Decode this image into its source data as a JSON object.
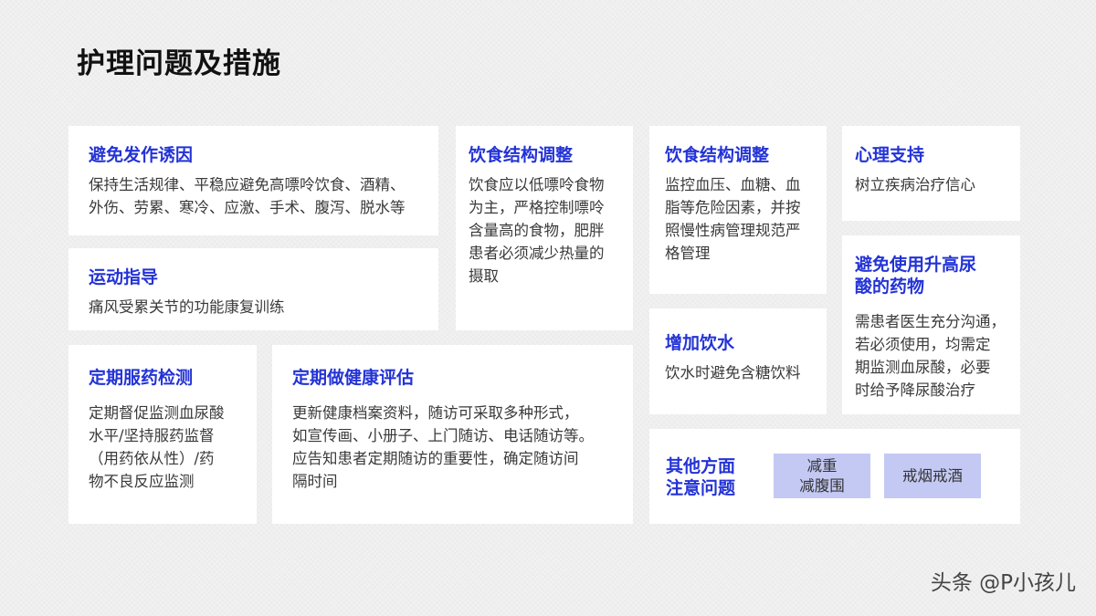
{
  "page_title": "护理问题及措施",
  "cards": {
    "avoid_triggers": {
      "title": "避免发作诱因",
      "lines": [
        "保持生活规律、平稳应避免高嘌呤饮食、酒精、",
        "外伤、劳累、寒冷、应激、手术、腹泻、脱水等"
      ]
    },
    "exercise": {
      "title": "运动指导",
      "lines": [
        "痛风受累关节的功能康复训练"
      ]
    },
    "diet1": {
      "title": "饮食结构调整",
      "lines": [
        "饮食应以低嘌呤食物",
        "为主，严格控制嘌呤",
        "含量高的食物，肥胖",
        "患者必须减少热量的",
        "摄取"
      ]
    },
    "diet2": {
      "title": "饮食结构调整",
      "lines": [
        "监控血压、血糖、血",
        "脂等危险因素，并按",
        "照慢性病管理规范严",
        "格管理"
      ]
    },
    "psych": {
      "title": "心理支持",
      "lines": [
        "树立疾病治疗信心"
      ]
    },
    "avoid_drugs": {
      "title_lines": [
        "避免使用升高尿",
        "酸的药物"
      ],
      "lines": [
        "需患者医生充分沟通，",
        "若必须使用，均需定",
        "期监测血尿酸，必要",
        "时给予降尿酸治疗"
      ]
    },
    "water": {
      "title": "增加饮水",
      "lines": [
        "饮水时避免含糖饮料"
      ]
    },
    "med_monitor": {
      "title": "定期服药检测",
      "lines": [
        "定期督促监测血尿酸",
        "水平/坚持服药监督",
        "（用药依从性）/药",
        "物不良反应监测"
      ]
    },
    "health_eval": {
      "title": "定期做健康评估",
      "lines": [
        "更新健康档案资料，随访可采取多种形式，",
        "如宣传画、小册子、上门随访、电话随访等。",
        "应告知患者定期随访的重要性，确定随访间",
        "隔时间"
      ]
    },
    "other": {
      "title_lines": [
        "其他方面",
        "注意问题"
      ],
      "tag1_lines": [
        "减重",
        "减腹围"
      ],
      "tag2": "戒烟戒酒"
    }
  },
  "watermark": "头条 @P小孩儿",
  "colors": {
    "accent": "#2333d6",
    "tag_bg": "#c4c9f4",
    "card_bg": "#ffffff",
    "page_bg": "#f1f1f1"
  }
}
